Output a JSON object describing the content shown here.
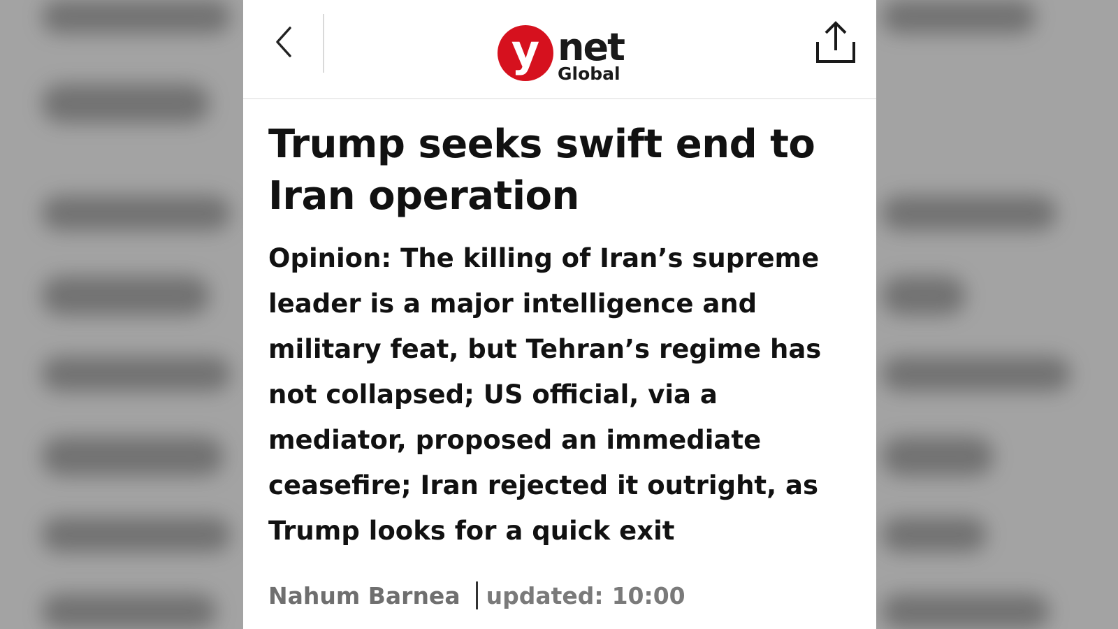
{
  "header": {
    "back_icon": "chevron-left-icon",
    "logo": {
      "mark_letter": "y",
      "wordmark": "net",
      "edition": "Global",
      "mark_color": "#d6111e"
    },
    "share_icon": "share-icon"
  },
  "article": {
    "headline": "Trump seeks swift end to Iran operation",
    "subtitle": "Opinion: The killing of Iran’s supreme leader is a major intelligence and military feat, but Tehran’s regime has not collapsed; US official, via a mediator, proposed an immediate ceasefire; Iran rejected it outright, as Trump looks for a quick exit",
    "author": "Nahum Barnea",
    "updated_label": "updated:",
    "updated_time": "10:00"
  },
  "colors": {
    "text": "#111111",
    "byline": "#7a7a7a",
    "background_blur": "#a3a3a3"
  }
}
